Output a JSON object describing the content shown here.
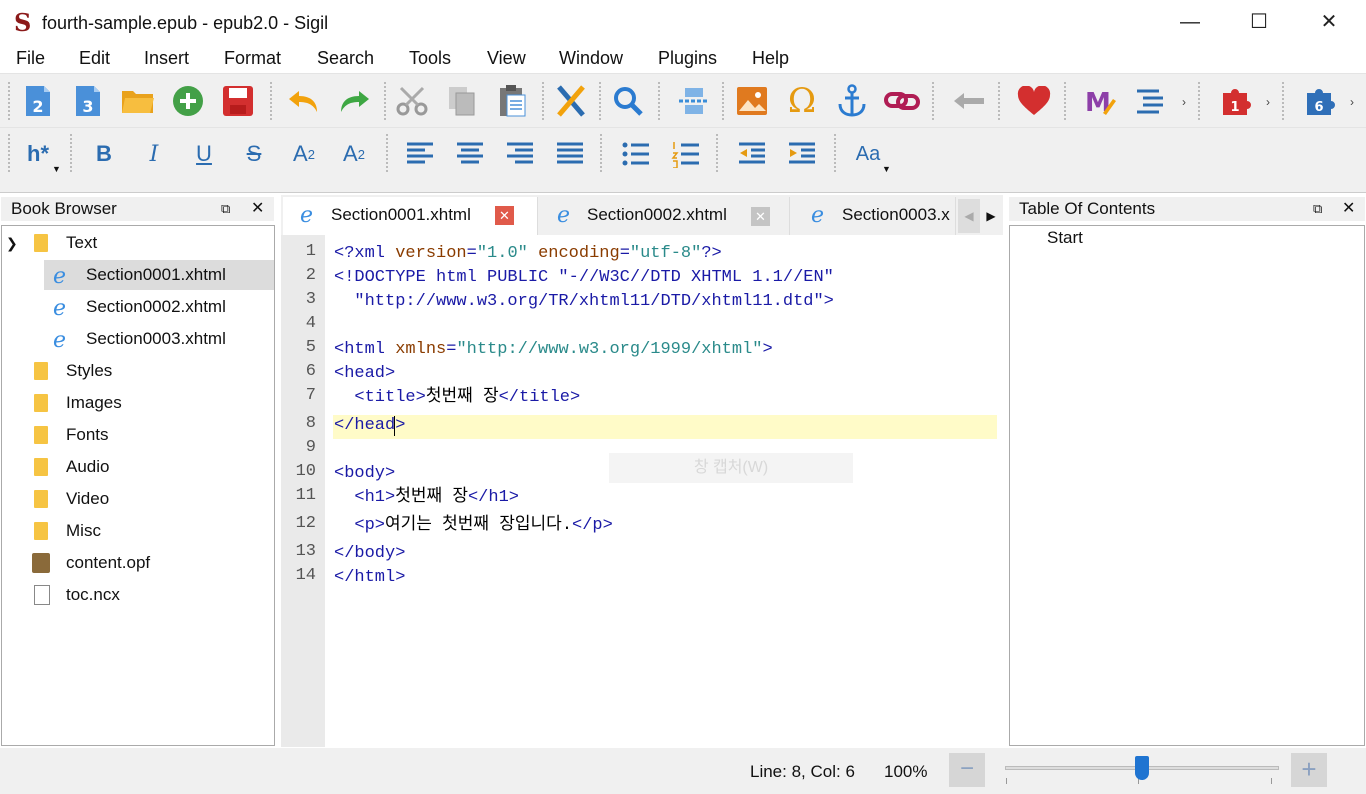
{
  "window": {
    "title": "fourth-sample.epub - epub2.0 - Sigil",
    "minimize": "—",
    "maximize": "☐",
    "close": "✕"
  },
  "menu": [
    "File",
    "Edit",
    "Insert",
    "Format",
    "Search",
    "Tools",
    "View",
    "Window",
    "Plugins",
    "Help"
  ],
  "toolbar1": {
    "icons": [
      "new-html-icon",
      "add-existing-icon",
      "open-icon",
      "add-icon",
      "save-icon",
      "undo-icon",
      "redo-icon",
      "cut-icon",
      "copy-icon",
      "paste-icon",
      "check-icon",
      "find-icon",
      "insert-file-icon",
      "insert-image-icon",
      "special-char-icon",
      "anchor-icon",
      "link-icon",
      "back-icon",
      "donate-icon",
      "metadata-icon",
      "toc-icon",
      "plugin-1-icon",
      "plugin-6-icon"
    ],
    "badges": {
      "new1": "2",
      "new2": "3",
      "plugin1": "1",
      "plugin6": "6"
    }
  },
  "toolbar2": {
    "heading": "h*",
    "bold": "B",
    "italic": "I",
    "underline": "U",
    "strike": "S",
    "subscript": "A",
    "sub_mark": "2",
    "superscript": "A",
    "sup_mark": "2",
    "case": "Aa"
  },
  "book_browser": {
    "title": "Book Browser",
    "items": [
      {
        "label": "Text",
        "type": "folder",
        "expanded": true
      },
      {
        "label": "Section0001.xhtml",
        "type": "html",
        "selected": true
      },
      {
        "label": "Section0002.xhtml",
        "type": "html"
      },
      {
        "label": "Section0003.xhtml",
        "type": "html"
      },
      {
        "label": "Styles",
        "type": "folder"
      },
      {
        "label": "Images",
        "type": "folder"
      },
      {
        "label": "Fonts",
        "type": "folder"
      },
      {
        "label": "Audio",
        "type": "folder"
      },
      {
        "label": "Video",
        "type": "folder"
      },
      {
        "label": "Misc",
        "type": "folder"
      },
      {
        "label": "content.opf",
        "type": "opf"
      },
      {
        "label": "toc.ncx",
        "type": "file"
      }
    ]
  },
  "tabs": [
    {
      "label": "Section0001.xhtml",
      "active": true
    },
    {
      "label": "Section0002.xhtml",
      "active": false
    },
    {
      "label": "Section0003.x",
      "active": false
    }
  ],
  "editor": {
    "lines": [
      {
        "n": "1",
        "parts": [
          [
            "tag",
            "<?xml "
          ],
          [
            "attr",
            "version"
          ],
          [
            "tag",
            "="
          ],
          [
            "str",
            "\"1.0\""
          ],
          [
            "tag",
            " "
          ],
          [
            "attr",
            "encoding"
          ],
          [
            "tag",
            "="
          ],
          [
            "str",
            "\"utf-8\""
          ],
          [
            "tag",
            "?>"
          ]
        ]
      },
      {
        "n": "2",
        "parts": [
          [
            "tag",
            "<!DOCTYPE html PUBLIC \"-//W3C//DTD XHTML 1.1//EN\""
          ]
        ]
      },
      {
        "n": "3",
        "parts": [
          [
            "tag",
            "  \"http://www.w3.org/TR/xhtml11/DTD/xhtml11.dtd\">"
          ]
        ]
      },
      {
        "n": "4",
        "parts": []
      },
      {
        "n": "5",
        "parts": [
          [
            "tag",
            "<html "
          ],
          [
            "attr",
            "xmlns"
          ],
          [
            "tag",
            "="
          ],
          [
            "str",
            "\"http://www.w3.org/1999/xhtml\""
          ],
          [
            "tag",
            ">"
          ]
        ]
      },
      {
        "n": "6",
        "parts": [
          [
            "tag",
            "<head>"
          ]
        ]
      },
      {
        "n": "7",
        "parts": [
          [
            "tag",
            "  <title>"
          ],
          [
            "txt",
            "첫번째 장"
          ],
          [
            "tag",
            "</title>"
          ]
        ]
      },
      {
        "n": "8",
        "parts": [
          [
            "tag",
            "</head>"
          ]
        ]
      },
      {
        "n": "9",
        "parts": []
      },
      {
        "n": "10",
        "parts": [
          [
            "tag",
            "<body>"
          ]
        ]
      },
      {
        "n": "11",
        "parts": [
          [
            "tag",
            "  <h1>"
          ],
          [
            "txt",
            "첫번째 장"
          ],
          [
            "tag",
            "</h1>"
          ]
        ]
      },
      {
        "n": "12",
        "parts": [
          [
            "tag",
            "  <p>"
          ],
          [
            "txt",
            "여기는 첫번째 장입니다."
          ],
          [
            "tag",
            "</p>"
          ]
        ]
      },
      {
        "n": "13",
        "parts": [
          [
            "tag",
            "</body>"
          ]
        ]
      },
      {
        "n": "14",
        "parts": [
          [
            "tag",
            "</html>"
          ]
        ]
      }
    ],
    "current_line": 8,
    "watermark": "창 캡처(W)"
  },
  "toc": {
    "title": "Table Of Contents",
    "items": [
      "Start"
    ]
  },
  "status": {
    "position": "Line: 8, Col: 6",
    "zoom": "100%",
    "zoom_out": "−",
    "zoom_in": "+",
    "zoom_level": 0.7
  }
}
